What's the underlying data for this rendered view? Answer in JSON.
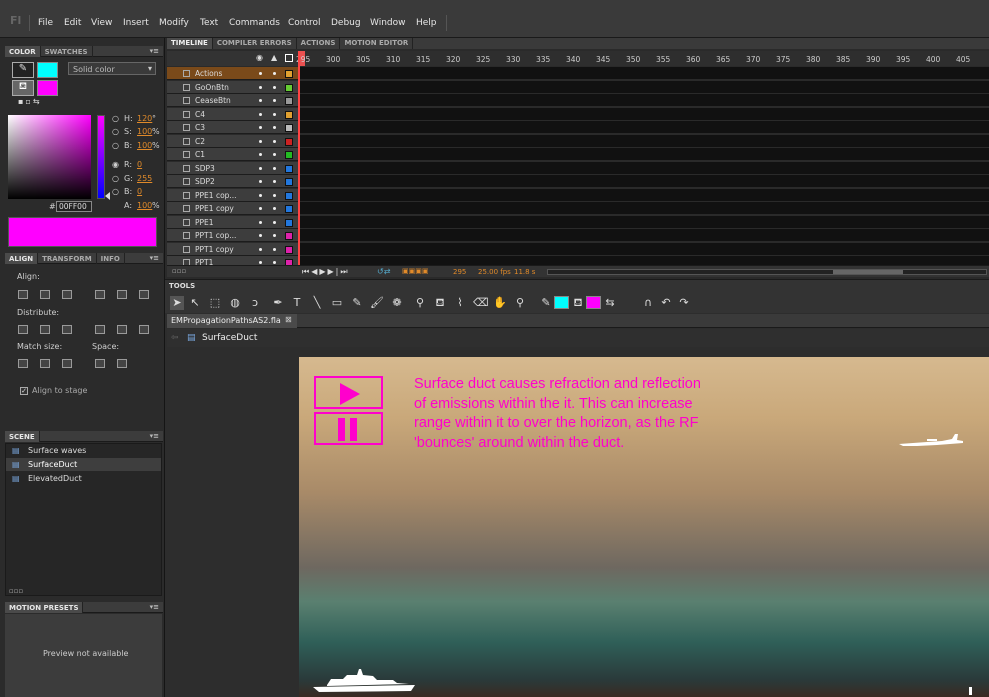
{
  "menu": [
    "File",
    "Edit",
    "View",
    "Insert",
    "Modify",
    "Text",
    "Commands",
    "Control",
    "Debug",
    "Window",
    "Help"
  ],
  "app_logo": "Fl",
  "color_panel": {
    "tabs": [
      "COLOR",
      "SWATCHES"
    ],
    "fill_type": "Solid color",
    "H": "120",
    "S": "100",
    "B": "100",
    "R": "0",
    "G": "255",
    "B2": "0",
    "A": "100",
    "hex": "00FF00",
    "hash": "#",
    "deg": "°",
    "pct": "%",
    "stroke": "#00ffff",
    "fill": "#ff00ff",
    "labels": {
      "H": "H:",
      "S": "S:",
      "B": "B:",
      "R": "R:",
      "G": "G:",
      "B2": "B:",
      "A": "A:"
    }
  },
  "align_panel": {
    "tabs": [
      "ALIGN",
      "TRANSFORM",
      "INFO"
    ],
    "align": "Align:",
    "distribute": "Distribute:",
    "match": "Match size:",
    "space": "Space:",
    "stage": "Align to stage"
  },
  "scene_panel": {
    "title": "SCENE",
    "items": [
      "Surface waves",
      "SurfaceDuct",
      "ElevatedDuct"
    ]
  },
  "presets": {
    "title": "MOTION PRESETS",
    "preview": "Preview not available"
  },
  "timeline": {
    "tabs": [
      "TIMELINE",
      "COMPILER ERRORS",
      "ACTIONS",
      "MOTION EDITOR"
    ],
    "ticks": [
      "295",
      "300",
      "305",
      "310",
      "315",
      "320",
      "325",
      "330",
      "335",
      "340",
      "345",
      "350",
      "355",
      "360",
      "365",
      "370",
      "375",
      "380",
      "385",
      "390",
      "395",
      "400",
      "405"
    ],
    "layers": [
      {
        "name": "Actions",
        "color": "#e0a030"
      },
      {
        "name": "GoOnBtn",
        "color": "#66cc33"
      },
      {
        "name": "CeaseBtn",
        "color": "#999999"
      },
      {
        "name": "C4",
        "color": "#e0a030"
      },
      {
        "name": "C3",
        "color": "#bbbbbb"
      },
      {
        "name": "C2",
        "color": "#cc2222"
      },
      {
        "name": "C1",
        "color": "#22bb22"
      },
      {
        "name": "SDP3",
        "color": "#2277dd"
      },
      {
        "name": "SDP2",
        "color": "#2277dd"
      },
      {
        "name": "PPE1 cop...",
        "color": "#2277dd"
      },
      {
        "name": "PPE1 copy",
        "color": "#2277dd"
      },
      {
        "name": "PPE1",
        "color": "#2277dd"
      },
      {
        "name": "PPT1 cop...",
        "color": "#dd22aa"
      },
      {
        "name": "PPT1 copy",
        "color": "#dd22aa"
      },
      {
        "name": "PPT1",
        "color": "#dd22aa"
      }
    ],
    "frame": "295",
    "fps": "25.00 fps",
    "time": "11.8 s"
  },
  "tools_title": "TOOLS",
  "doc_tab": "EMPropagationPathsAS2.fla",
  "scene_crumb": "SurfaceDuct",
  "stage_text": "Surface duct causes refraction and reflection of emissions within the it. This can increase range within it to over the horizon, as the RF 'bounces' around within the duct."
}
